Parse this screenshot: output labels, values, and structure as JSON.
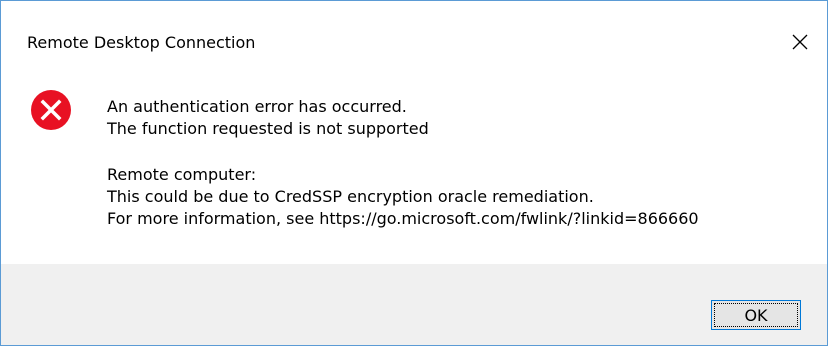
{
  "window": {
    "title": "Remote Desktop Connection",
    "close_glyph": "✕"
  },
  "message": {
    "line1": "An authentication error has occurred.",
    "line2": "The function requested is not supported",
    "line3": "Remote computer:",
    "line4": "This could be due to CredSSP encryption oracle remediation.",
    "line5": "For more information, see https://go.microsoft.com/fwlink/?linkid=866660"
  },
  "buttons": {
    "ok_label": "OK"
  },
  "icons": {
    "error": "error-icon",
    "close": "close-icon"
  },
  "colors": {
    "error_red": "#e81123",
    "footer_bg": "#f0f0f0",
    "accent_border": "#0078d7"
  }
}
